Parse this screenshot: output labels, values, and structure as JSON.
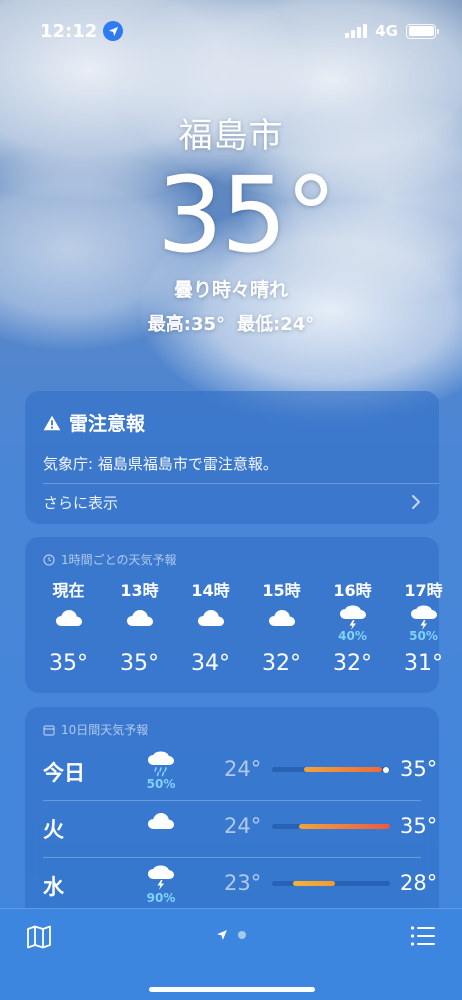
{
  "status_bar": {
    "time": "12:12",
    "network": "4G",
    "icons": [
      "location-arrow-icon",
      "signal-bars-icon",
      "battery-icon"
    ]
  },
  "hero": {
    "city": "福島市",
    "temperature": "35°",
    "condition": "曇り時々晴れ",
    "high": "最高:35°",
    "low": "最低:24°"
  },
  "alert": {
    "icon": "warning-icon",
    "title": "雷注意報",
    "body": "気象庁: 福島県福島市で雷注意報。",
    "more_label": "さらに表示"
  },
  "hourly": {
    "heading": "1時間ごとの天気予報",
    "hours": [
      {
        "time": "現在",
        "icon": "cloud-icon",
        "pop": "",
        "temp": "35°"
      },
      {
        "time": "13時",
        "icon": "cloud-icon",
        "pop": "",
        "temp": "35°"
      },
      {
        "time": "14時",
        "icon": "cloud-icon",
        "pop": "",
        "temp": "34°"
      },
      {
        "time": "15時",
        "icon": "cloud-icon",
        "pop": "",
        "temp": "32°"
      },
      {
        "time": "16時",
        "icon": "thunderstorm-icon",
        "pop": "40%",
        "temp": "32°"
      },
      {
        "time": "17時",
        "icon": "thunderstorm-icon",
        "pop": "50%",
        "temp": "31°"
      }
    ]
  },
  "daily": {
    "heading": "10日間天気予報",
    "days": [
      {
        "day": "今日",
        "icon": "rain-cloud-icon",
        "pop": "50%",
        "low": "24°",
        "high": "35°",
        "range_start": 0.27,
        "range_end": 0.93,
        "current": 0.97,
        "gradient": [
          "#f2a33a",
          "#ef6a3a"
        ]
      },
      {
        "day": "火",
        "icon": "cloud-icon",
        "pop": "",
        "low": "24°",
        "high": "35°",
        "range_start": 0.23,
        "range_end": 1.0,
        "gradient": [
          "#f2a33a",
          "#ea5a45"
        ]
      },
      {
        "day": "水",
        "icon": "thunderstorm-icon",
        "pop": "90%",
        "low": "23°",
        "high": "28°",
        "range_start": 0.18,
        "range_end": 0.53,
        "gradient": [
          "#f2b23a",
          "#f29a35"
        ]
      }
    ]
  },
  "tabbar": {
    "icons": [
      "map-icon",
      "location-arrow-icon",
      "list-icon"
    ]
  }
}
